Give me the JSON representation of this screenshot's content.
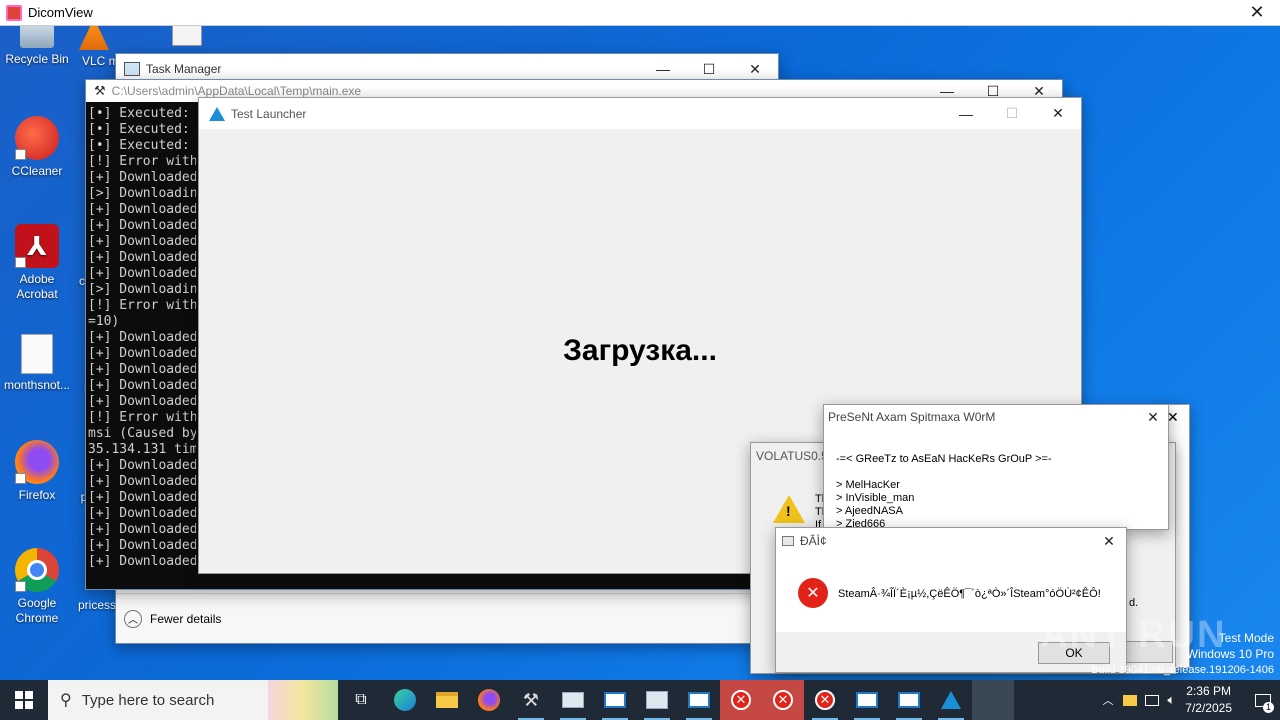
{
  "dicomview": {
    "title": "DicomView"
  },
  "desktop_icons": [
    {
      "label": "Recycle Bin"
    },
    {
      "label": "VLC m"
    },
    {
      "label": "CCleaner"
    },
    {
      "label": "Adobe\nAcrobat"
    },
    {
      "label": "monthsnot..."
    },
    {
      "label": "Firefox"
    },
    {
      "label": "Google\nChrome"
    },
    {
      "label": "pricess"
    },
    {
      "label": "c"
    },
    {
      "label": "r"
    },
    {
      "label": "p"
    }
  ],
  "task_manager": {
    "title": "Task Manager",
    "fewer_details": "Fewer details"
  },
  "console": {
    "title": "C:\\Users\\admin\\AppData\\Local\\Temp\\main.exe",
    "lines": [
      "[•] Executed:",
      "[•] Executed:",
      "[•] Executed:",
      "[!] Error with",
      "[+] Downloaded",
      "[>] Downloadin",
      "[+] Downloaded",
      "[+] Downloaded",
      "[+] Downloaded",
      "[+] Downloaded",
      "[+] Downloaded",
      "[>] Downloadin",
      "[!] Error with",
      "=10)",
      "[+] Downloaded",
      "[+] Downloaded",
      "[+] Downloaded",
      "[+] Downloaded",
      "[+] Downloaded",
      "[!] Error with",
      "msi (Caused by",
      "35.134.131 tim",
      "[+] Downloaded",
      "[+] Downloaded",
      "[+] Downloaded",
      "[+] Downloaded",
      "[+] Downloaded",
      "[+] Downloaded",
      "[+] Downloaded"
    ]
  },
  "test_launcher": {
    "title": "Test Launcher",
    "loading_text": "Загрузка..."
  },
  "present_dialog": {
    "title": "PreSeNt Axam Spitmaxa W0rM",
    "greetz": "-=< GReeTz to AsEaN HacKeRs GrOuP >=-",
    "names": [
      "> MelHacKer",
      "> InVisible_man",
      "> AjeedNASA",
      "> Zied666"
    ]
  },
  "volatus_dialog": {
    "title": "VOLATUS0.5",
    "lines": [
      "Th",
      "Th",
      "If"
    ],
    "trailing": "d."
  },
  "error_dialog": {
    "title": "ÐÂÌ¢",
    "message": "SteamÂ·¾ÎÏ´È¡µ½,ÇëÊÖ¶¯´ò¿ªÒ»´ÎSteam°óÖÙ²¢ÊÔ!",
    "ok_label": "OK"
  },
  "watermark": {
    "text": "ANY RUN",
    "mode": "Test Mode",
    "os": "Windows 10 Pro",
    "build": "Build 19041.vb_release.191206-1406"
  },
  "taskbar": {
    "search_placeholder": "Type here to search",
    "time": "2:36 PM",
    "date": "7/2/2025",
    "notification_count": "1"
  },
  "colors": {
    "desktop": "#0a6ad8",
    "taskbar": "#1f2a36",
    "error_red": "#e2231a",
    "active_task": "#c54844"
  }
}
